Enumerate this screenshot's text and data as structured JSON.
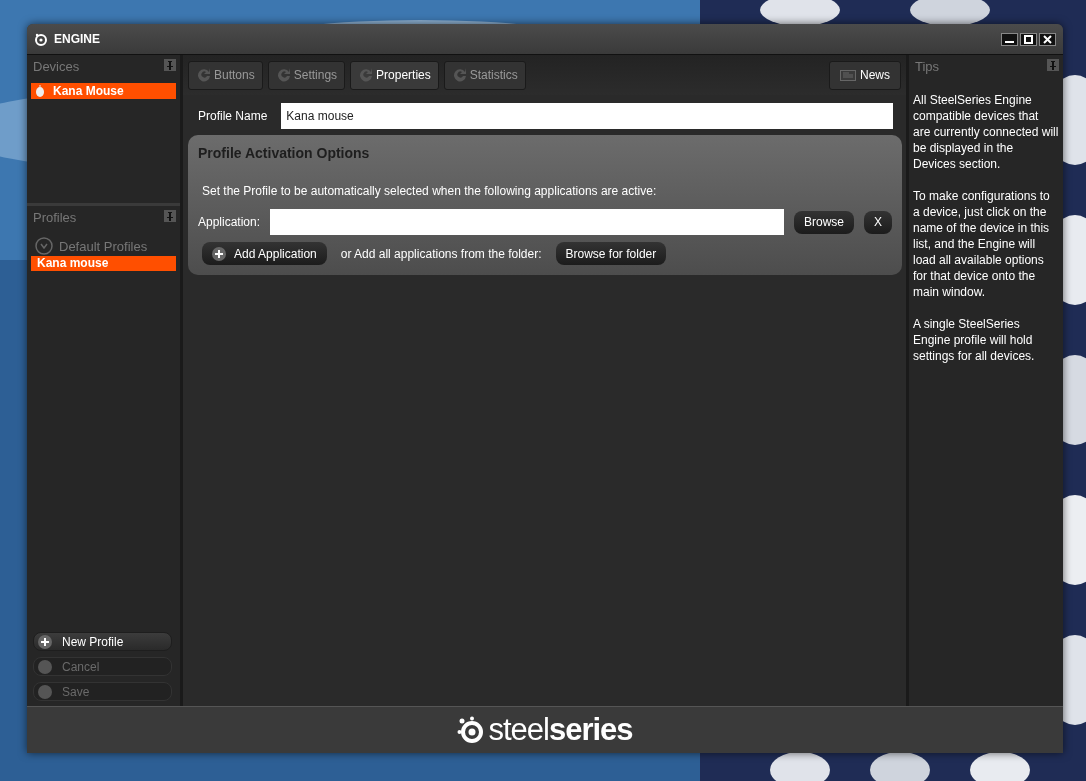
{
  "window": {
    "title": "ENGINE"
  },
  "devices": {
    "title": "Devices",
    "items": [
      {
        "label": "Kana Mouse",
        "selected": true
      }
    ]
  },
  "profiles": {
    "title": "Profiles",
    "items": [
      {
        "kind": "group",
        "label": "Default Profiles",
        "expanded": false
      },
      {
        "kind": "profile",
        "label": "Kana mouse",
        "selected": true
      }
    ]
  },
  "profile_actions": [
    {
      "kind": "add",
      "label": "New Profile",
      "disabled": false
    },
    {
      "kind": "plain",
      "label": "Cancel",
      "disabled": true
    },
    {
      "kind": "plain",
      "label": "Save",
      "disabled": true
    }
  ],
  "tabs": [
    {
      "label": "Buttons",
      "selected": false
    },
    {
      "label": "Settings",
      "selected": false
    },
    {
      "label": "Properties",
      "selected": true
    },
    {
      "label": "Statistics",
      "selected": false
    }
  ],
  "news_button": "News",
  "profile_name": {
    "label": "Profile Name",
    "value": "Kana mouse"
  },
  "activation": {
    "title": "Profile Activation Options",
    "description": "Set the Profile to be automatically selected when the following applications are active:",
    "application_label": "Application:",
    "browse_button": "Browse",
    "clear_button": "X",
    "add_button": "Add Application",
    "folder_text": "or Add all applications from the folder:",
    "folder_button": "Browse for folder"
  },
  "tips": {
    "title": "Tips",
    "paragraphs": [
      "All SteelSeries Engine compatible devices that are currently connected will be displayed in the Devices section.",
      "To make configurations to a device, just click on the name of the device in this list, and the Engine will load all available options for that device onto the main window.",
      "A single SteelSeries Engine profile will hold settings for all devices."
    ]
  },
  "footer": {
    "logo": "steel**series**"
  }
}
